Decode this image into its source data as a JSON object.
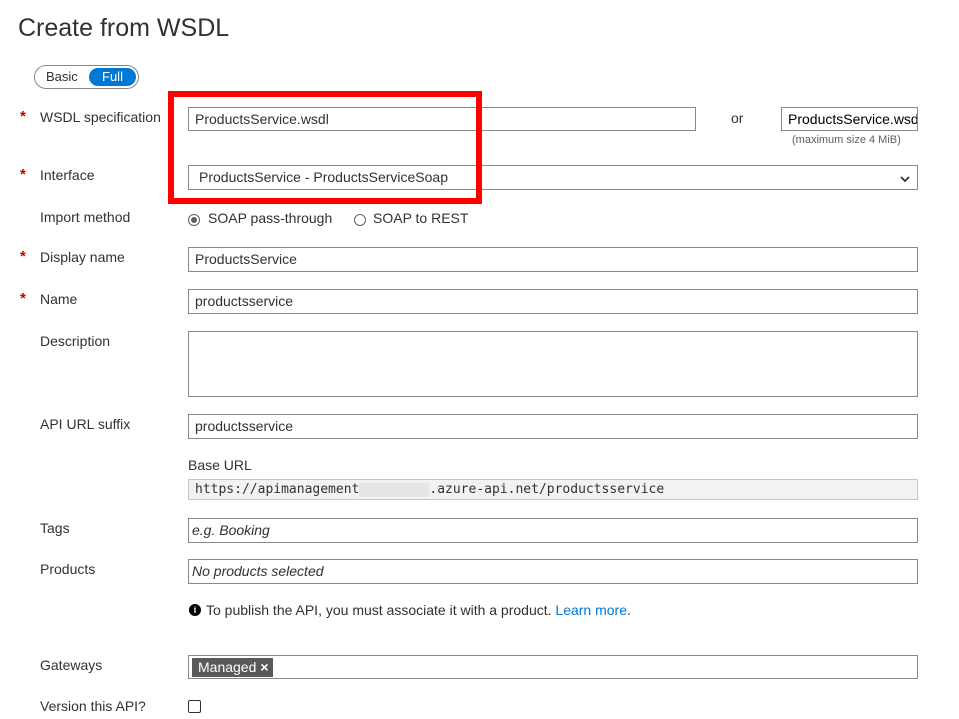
{
  "page": {
    "title": "Create from WSDL"
  },
  "mode_toggle": {
    "basic": "Basic",
    "full": "Full",
    "selected": "Full"
  },
  "required_marker": "*",
  "wsdl": {
    "label": "WSDL specification",
    "url_value": "ProductsService.wsdl",
    "or_text": "or",
    "file_value": "ProductsService.wsdl",
    "max_size_note": "(maximum size 4 MiB)"
  },
  "interface": {
    "label": "Interface",
    "selected": "ProductsService - ProductsServiceSoap",
    "arrow": "⌄"
  },
  "import_method": {
    "label": "Import method",
    "options": [
      "SOAP pass-through",
      "SOAP to REST"
    ],
    "selected": "SOAP pass-through"
  },
  "display_name": {
    "label": "Display name",
    "value": "ProductsService"
  },
  "name": {
    "label": "Name",
    "value": "productsservice"
  },
  "description": {
    "label": "Description",
    "value": ""
  },
  "api_url_suffix": {
    "label": "API URL suffix",
    "value": "productsservice"
  },
  "base_url": {
    "label": "Base URL",
    "prefix": "https://apimanagement",
    "suffix": ".azure-api.net/productsservice"
  },
  "tags": {
    "label": "Tags",
    "placeholder": "e.g. Booking"
  },
  "products": {
    "label": "Products",
    "placeholder": "No products selected",
    "info_text": "To publish the API, you must associate it with a product.",
    "learn_more": "Learn more",
    "learn_more_end": "."
  },
  "gateways": {
    "label": "Gateways",
    "chip": "Managed",
    "chip_remove": "×"
  },
  "version": {
    "label": "Version this API?",
    "checked": false
  },
  "icons": {
    "info": "info-icon",
    "dropdown": "chevron-down-icon",
    "remove": "close-icon",
    "resize": "resize-grip-icon"
  },
  "colors": {
    "accent": "#0078d4",
    "required": "#c00000",
    "highlight": "#ff0000",
    "chip_bg": "#5a5a5a"
  }
}
